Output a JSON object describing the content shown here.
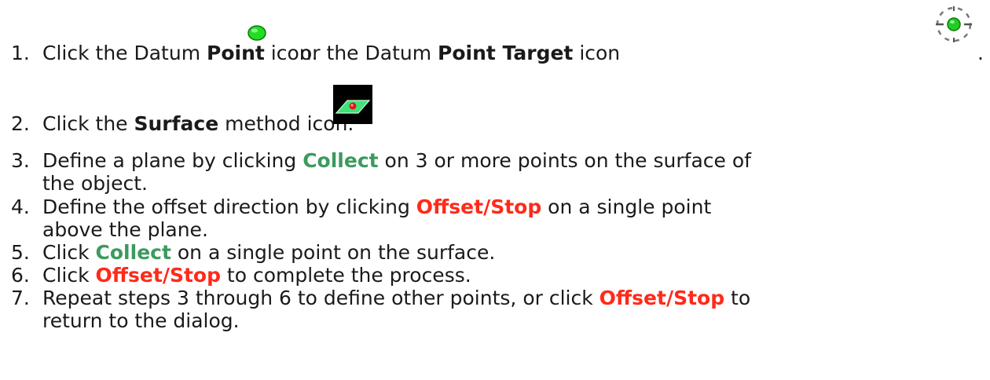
{
  "colors": {
    "text": "#1a1a1a",
    "collect_green": "#3c9a5f",
    "offset_red": "#ff2a1a",
    "point_icon_green": "#22dd22"
  },
  "icons": {
    "datum_point": "green-dot-icon",
    "datum_point_target": "target-crosshair-icon",
    "surface_method": "surface-plane-icon"
  },
  "steps": [
    {
      "num": "1.",
      "t1": "Click the Datum ",
      "b1": "Point",
      "t2": " icon.",
      "t3": "or the Datum ",
      "b2": "Point Target",
      "t4": " icon",
      "t5": "."
    },
    {
      "num": "2.",
      "t1": "Click the ",
      "b1": "Surface",
      "t2": " method icon."
    },
    {
      "num": "3.",
      "t1": "Define a plane by clicking ",
      "k1": "Collect",
      "t2": " on 3 or more  points on the surface of",
      "t3": "the object."
    },
    {
      "num": "4.",
      "t1": "Define the offset direction by clicking ",
      "k1": "Offset/Stop",
      "t2": " on a single point",
      "t3": "above the plane."
    },
    {
      "num": "5.",
      "t1": "Click ",
      "k1": "Collect",
      "t2": " on a single point on the surface."
    },
    {
      "num": "6.",
      "t1": "Click ",
      "k1": "Offset/Stop",
      "t2": " to complete the process."
    },
    {
      "num": "7.",
      "t1": "Repeat steps 3 through 6 to define other points, or click ",
      "k1": "Offset/Stop",
      "t2": " to",
      "t3": "return to the dialog."
    }
  ]
}
